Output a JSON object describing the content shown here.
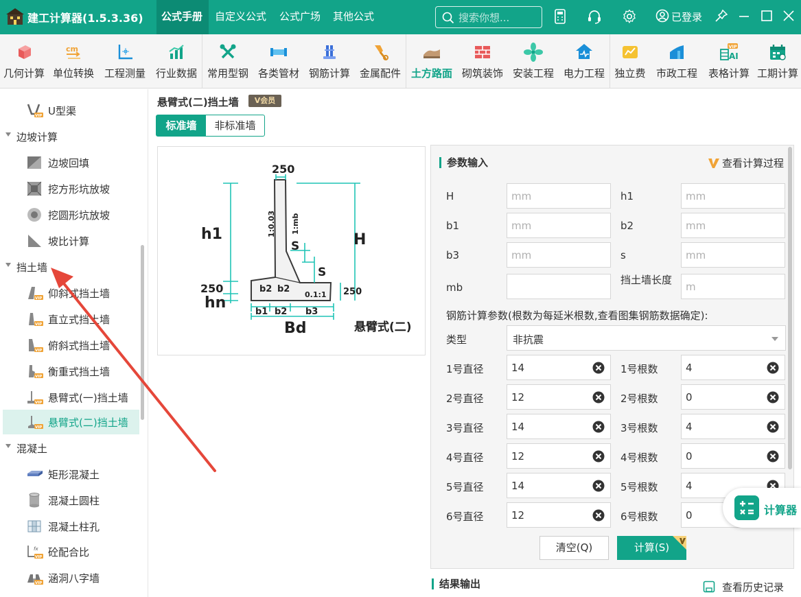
{
  "app": {
    "title": "建工计算器(1.5.3.36)"
  },
  "nav_tabs": [
    {
      "label": "公式手册"
    },
    {
      "label": "自定义公式"
    },
    {
      "label": "公式广场"
    },
    {
      "label": "其他公式"
    }
  ],
  "search": {
    "placeholder": "搜索你想..."
  },
  "user": {
    "login_label": "已登录"
  },
  "toolbar": [
    {
      "label": "几何计算",
      "icon": "cube-icon"
    },
    {
      "label": "单位转换",
      "icon": "unit-convert-icon"
    },
    {
      "label": "工程测量",
      "icon": "survey-icon"
    },
    {
      "label": "行业数据",
      "icon": "bar-chart-icon"
    },
    {
      "label": "常用型钢",
      "icon": "tools-icon"
    },
    {
      "label": "各类管材",
      "icon": "pipe-icon"
    },
    {
      "label": "钢筋计算",
      "icon": "rebar-icon"
    },
    {
      "label": "金属配件",
      "icon": "hardware-icon"
    },
    {
      "label": "土方路面",
      "icon": "earthwork-icon"
    },
    {
      "label": "砌筑装饰",
      "icon": "brick-wall-icon"
    },
    {
      "label": "安装工程",
      "icon": "fan-icon"
    },
    {
      "label": "电力工程",
      "icon": "power-icon"
    },
    {
      "label": "独立费",
      "icon": "fee-icon"
    },
    {
      "label": "市政工程",
      "icon": "municipal-icon"
    },
    {
      "label": "表格计算",
      "icon": "ai-table-icon"
    },
    {
      "label": "工期计算",
      "icon": "calendar-icon"
    }
  ],
  "sidebar": {
    "items": [
      {
        "label": "U型渠"
      },
      {
        "label": "边坡计算"
      },
      {
        "label": "边坡回填"
      },
      {
        "label": "挖方形坑放坡"
      },
      {
        "label": "挖圆形坑放坡"
      },
      {
        "label": "坡比计算"
      },
      {
        "label": "挡土墙"
      },
      {
        "label": "仰斜式挡土墙"
      },
      {
        "label": "直立式挡土墙"
      },
      {
        "label": "俯斜式挡土墙"
      },
      {
        "label": "衡重式挡土墙"
      },
      {
        "label": "悬臂式(一)挡土墙"
      },
      {
        "label": "悬臂式(二)挡土墙"
      },
      {
        "label": "混凝土"
      },
      {
        "label": "矩形混凝土"
      },
      {
        "label": "混凝土圆柱"
      },
      {
        "label": "混凝土柱孔"
      },
      {
        "label": "砼配合比"
      },
      {
        "label": "涵洞八字墙"
      }
    ]
  },
  "main": {
    "title": "悬臂式(二)挡土墙",
    "vip_badge": "会员",
    "segments": [
      {
        "label": "标准墙"
      },
      {
        "label": "非标准墙"
      }
    ],
    "diagram": {
      "caption": "悬臂式(二)",
      "labels": {
        "top": "250",
        "h1": "h1",
        "H": "H",
        "left_250": "250",
        "hn": "hn",
        "slope_left": "1:0.03",
        "slope_right": "1:mb",
        "s1": "S",
        "s2": "S",
        "b2a": "b2",
        "b2b": "b2",
        "ratio": "0.1:1",
        "right_250": "250",
        "b1": "b1",
        "b2c": "b2",
        "b3": "b3",
        "Bd": "Bd"
      }
    },
    "params": {
      "heading": "参数输入",
      "view_process": "查看计算过程",
      "fields": [
        {
          "label": "H",
          "placeholder": "mm"
        },
        {
          "label": "h1",
          "placeholder": "mm"
        },
        {
          "label": "b1",
          "placeholder": "mm"
        },
        {
          "label": "b2",
          "placeholder": "mm"
        },
        {
          "label": "b3",
          "placeholder": "mm"
        },
        {
          "label": "s",
          "placeholder": "mm"
        },
        {
          "label": "mb",
          "placeholder": ""
        },
        {
          "label": "挡土墙长度",
          "placeholder": "m"
        }
      ],
      "rebar_note": "钢筋计算参数(根数为每延米根数,查看图集钢筋数据确定):",
      "type_label": "类型",
      "type_value": "非抗震",
      "rebar": [
        {
          "dia_label": "1号直径",
          "dia": "14",
          "cnt_label": "1号根数",
          "cnt": "4"
        },
        {
          "dia_label": "2号直径",
          "dia": "12",
          "cnt_label": "2号根数",
          "cnt": "0"
        },
        {
          "dia_label": "3号直径",
          "dia": "14",
          "cnt_label": "3号根数",
          "cnt": "4"
        },
        {
          "dia_label": "4号直径",
          "dia": "12",
          "cnt_label": "4号根数",
          "cnt": "0"
        },
        {
          "dia_label": "5号直径",
          "dia": "14",
          "cnt_label": "5号根数",
          "cnt": "4"
        },
        {
          "dia_label": "6号直径",
          "dia": "12",
          "cnt_label": "6号根数",
          "cnt": "0"
        }
      ],
      "clear_label": "清空(Q)",
      "calc_label": "计算(S)"
    },
    "result_heading": "结果输出",
    "history_label": "查看历史记录",
    "calculator_label": "计算器"
  },
  "colors": {
    "primary": "#12a489",
    "dim_lines": "#1fc4b5",
    "annotation_arrow": "#e5473a"
  }
}
